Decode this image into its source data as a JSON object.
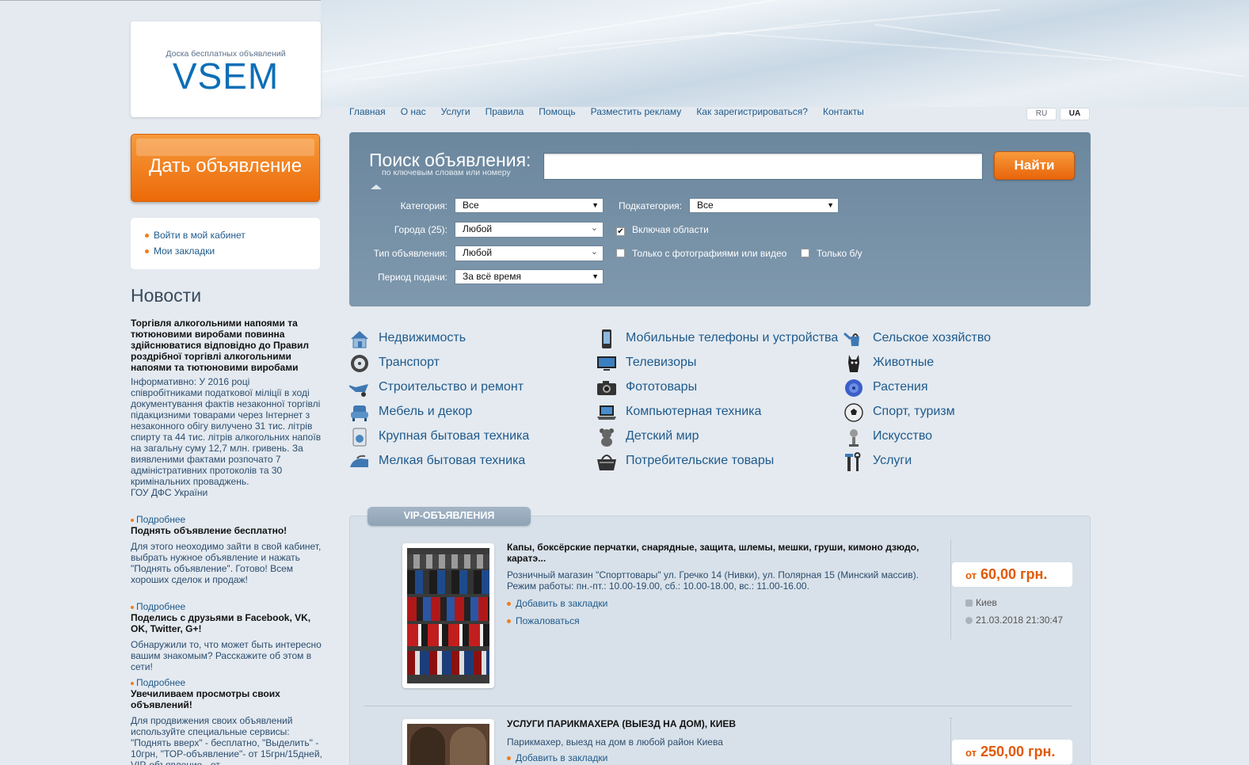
{
  "logo": {
    "tagline": "Доска бесплатных объявлений",
    "wordmark": "VSEM",
    "color": "#0c6fb7"
  },
  "post_button": {
    "label": "Дать объявление"
  },
  "user_links": [
    {
      "label": "Войти в мой кабинет"
    },
    {
      "label": "Мои закладки"
    }
  ],
  "nav": [
    {
      "label": "Главная"
    },
    {
      "label": "О нас"
    },
    {
      "label": "Услуги"
    },
    {
      "label": "Правила"
    },
    {
      "label": "Помощь"
    },
    {
      "label": "Разместить рекламу"
    },
    {
      "label": "Как зарегистрироваться?"
    },
    {
      "label": "Контакты"
    }
  ],
  "languages": [
    {
      "label": "RU",
      "active": false
    },
    {
      "label": "UA",
      "active": true
    }
  ],
  "search": {
    "title": "Поиск объявления:",
    "subtitle": "по ключевым словам или номеру",
    "query": "",
    "button": "Найти",
    "category_label": "Категория:",
    "category_value": "Все",
    "subcategory_label": "Подкатегория:",
    "subcategory_value": "Все",
    "city_label": "Города (25):",
    "city_value": "Любой",
    "include_regions": "Включая области",
    "include_regions_checked": true,
    "type_label": "Тип объявления:",
    "type_value": "Любой",
    "with_photo": "Только с фотографиями или видео",
    "with_photo_checked": false,
    "used_only": "Только б/у",
    "used_only_checked": false,
    "period_label": "Период подачи:",
    "period_value": "За всё время"
  },
  "categories": [
    {
      "label": "Недвижимость",
      "icon": "house-icon"
    },
    {
      "label": "Транспорт",
      "icon": "wheel-icon"
    },
    {
      "label": "Строительство и ремонт",
      "icon": "wheelbarrow-icon"
    },
    {
      "label": "Мебель и декор",
      "icon": "armchair-icon"
    },
    {
      "label": "Крупная бытовая техника",
      "icon": "washing-machine-icon"
    },
    {
      "label": "Мелкая бытовая техника",
      "icon": "iron-icon"
    },
    {
      "label": "Мобильные телефоны и устройства",
      "icon": "phone-icon"
    },
    {
      "label": "Телевизоры",
      "icon": "tv-icon"
    },
    {
      "label": "Фототовары",
      "icon": "camera-icon"
    },
    {
      "label": "Компьютерная техника",
      "icon": "laptop-icon"
    },
    {
      "label": "Детский мир",
      "icon": "teddy-bear-icon"
    },
    {
      "label": "Потребительские товары",
      "icon": "basket-icon"
    },
    {
      "label": "Сельское хозяйство",
      "icon": "watering-can-icon"
    },
    {
      "label": "Животные",
      "icon": "cat-icon"
    },
    {
      "label": "Растения",
      "icon": "flower-icon"
    },
    {
      "label": "Спорт, туризм",
      "icon": "ball-icon"
    },
    {
      "label": "Искусство",
      "icon": "art-icon"
    },
    {
      "label": "Услуги",
      "icon": "tools-icon"
    }
  ],
  "news": {
    "heading": "Новости",
    "items": [
      {
        "title": "Торгівля алкогольними напоями та тютюновими виробами повинна здійснюватися відповідно до Правил роздрібної торгівлі алкогольними напоями та тютюновими виробами",
        "body": "Інформативно: У 2016 році співробітниками податкової міліції в ході документування фактів незаконної торгівлі підакцизними товарами через Інтернет з незаконного обігу вилучено 31 тис. літрів спирту та 44 тис. літрів алкогольних напоїв на загальну суму 12,7 млн. гривень. За виявленими фактами розпочато 7 адміністративних протоколів та 30 кримінальних проваджень.\nГОУ ДФС України",
        "more": "Подробнее"
      },
      {
        "title": "Поднять объявление бесплатно!",
        "body": "Для этого неоходимо зайти в свой кабинет, выбрать нужное объявление и нажать \"Поднять объявление\". Готово!  Всем хороших сделок и продаж!",
        "more": "Подробнее"
      },
      {
        "title": "Поделись с друзьями в Facebook, VK, OK, Twitter, G+!",
        "body": "Обнаружили то, что может быть интересно вашим знакомым? Расскажите об этом в сети!",
        "more": "Подробнее"
      },
      {
        "title": "Увечиливаем просмотры своих объявлений!",
        "body": "Для продвижения своих объявлений используйте специальные сервисы: \"Поднять вверх\" -  бесплатно, \"Выделить\" - 10грн, \"ТОР-объявление\"- от 15грн/15дней, VIP-объявление - от",
        "more": ""
      }
    ]
  },
  "vip": {
    "tab": "VIP-ОБЪЯВЛЕНИЯ",
    "ads": [
      {
        "title": "Капы, боксёрские перчатки, снарядные, защита, шлемы, мешки, груши, кимоно дзюдо, каратэ...",
        "desc": "Розничный магазин \"Спорттовары\" ул. Гречко 14 (Нивки), ул. Полярная 15 (Минский массив). Режим работы: пн.-пт.: 10.00-19.00, сб.: 10.00-18.00, вс.: 11.00-16.00.",
        "bookmark": "Добавить в закладки",
        "complain": "Пожаловаться",
        "price_prefix": "от",
        "price": "60,00 грн.",
        "city": "Киев",
        "date": "21.03.2018 21:30:47"
      },
      {
        "title": "УСЛУГИ ПАРИКМАХЕРА (ВЫЕЗД НА ДОМ), КИЕВ",
        "desc": "Парикмахер, выезд на дом в любой район Киева",
        "bookmark": "Добавить в закладки",
        "price_prefix": "от",
        "price": "250,00 грн."
      }
    ]
  },
  "colors": {
    "accent_orange": "#ec6a08",
    "link_blue": "#1f5a8c",
    "search_panel": "#7690a6"
  }
}
